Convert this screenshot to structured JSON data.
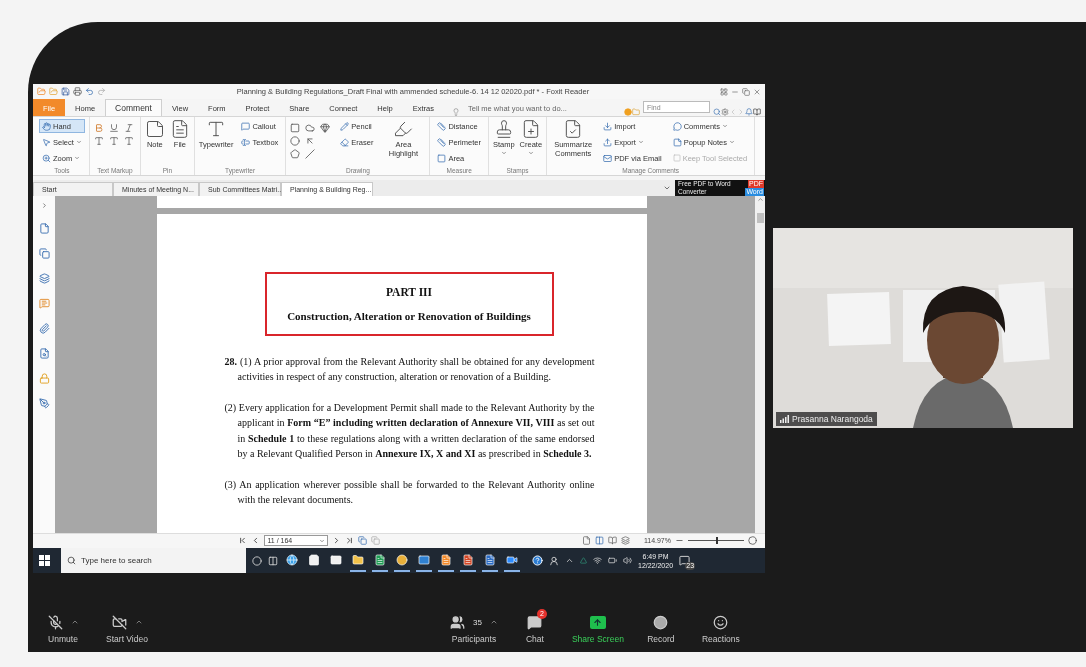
{
  "app_window": {
    "title": "Planning & Building Regulations_Draft Final with ammended schedule-6. 14 12 02020.pdf * - Foxit Reader",
    "menu_tabs": [
      {
        "label": "File",
        "kind": "file",
        "selected": false
      },
      {
        "label": "Home",
        "kind": "tab",
        "selected": false
      },
      {
        "label": "Comment",
        "kind": "tab",
        "selected": true
      },
      {
        "label": "View",
        "kind": "tab",
        "selected": false
      },
      {
        "label": "Form",
        "kind": "tab",
        "selected": false
      },
      {
        "label": "Protect",
        "kind": "tab",
        "selected": false
      },
      {
        "label": "Share",
        "kind": "tab",
        "selected": false
      },
      {
        "label": "Connect",
        "kind": "tab",
        "selected": false
      },
      {
        "label": "Help",
        "kind": "tab",
        "selected": false
      },
      {
        "label": "Extras",
        "kind": "tab",
        "selected": false
      }
    ],
    "tell_me": {
      "placeholder": "Tell me what you want to do..."
    },
    "find": {
      "placeholder": "Find"
    },
    "ribbon_groups": [
      {
        "label": "Tools",
        "kind": "tools",
        "items": [
          {
            "label": "Hand",
            "kind": "small",
            "selected": true,
            "dropdown": false
          },
          {
            "label": "Select",
            "kind": "small",
            "selected": false,
            "dropdown": true
          },
          {
            "label": "Zoom",
            "kind": "small",
            "selected": false,
            "dropdown": true
          }
        ]
      },
      {
        "label": "Text Markup",
        "kind": "markup"
      },
      {
        "label": "Pin",
        "kind": "pin",
        "items": [
          {
            "label": "Note",
            "kind": "large",
            "dropdown": false
          },
          {
            "label": "File",
            "kind": "large",
            "dropdown": false
          }
        ]
      },
      {
        "label": "Typewriter",
        "kind": "typewriter",
        "items": [
          {
            "label": "Typewriter",
            "kind": "large",
            "dropdown": false
          },
          {
            "label": "Callout",
            "kind": "small",
            "dropdown": false
          },
          {
            "label": "Textbox",
            "kind": "small",
            "dropdown": false
          }
        ]
      },
      {
        "label": "Drawing",
        "kind": "drawing",
        "items": [
          {
            "label": "Pencil",
            "kind": "small",
            "dropdown": false
          },
          {
            "label": "Eraser",
            "kind": "small",
            "dropdown": false
          },
          {
            "label": "Area Highlight",
            "kind": "large",
            "dropdown": false
          }
        ]
      },
      {
        "label": "Measure",
        "kind": "measure",
        "items": [
          {
            "label": "Distance",
            "kind": "small",
            "dropdown": false
          },
          {
            "label": "Perimeter",
            "kind": "small",
            "dropdown": false
          },
          {
            "label": "Area",
            "kind": "small",
            "dropdown": false
          }
        ]
      },
      {
        "label": "Stamps",
        "kind": "stamps",
        "items": [
          {
            "label": "Stamp",
            "kind": "large",
            "dropdown": true
          },
          {
            "label": "Create",
            "kind": "large",
            "dropdown": true
          }
        ]
      },
      {
        "label": "Manage Comments",
        "kind": "manage",
        "items": [
          {
            "label": "Summarize Comments",
            "kind": "large",
            "dropdown": false
          },
          {
            "label": "Import",
            "kind": "small",
            "dropdown": false
          },
          {
            "label": "Export",
            "kind": "small",
            "dropdown": true
          },
          {
            "label": "PDF via Email",
            "kind": "small",
            "dropdown": false
          },
          {
            "label": "Comments",
            "kind": "small",
            "dropdown": true
          },
          {
            "label": "Popup Notes",
            "kind": "small",
            "dropdown": true
          }
        ],
        "keep_tool_selected": {
          "label": "Keep Tool Selected",
          "disabled": true,
          "checked": false
        }
      }
    ],
    "doc_tabs": [
      {
        "label": "Start",
        "selected": false
      },
      {
        "label": "Minutes of Meeting N...",
        "selected": false
      },
      {
        "label": "Sub Committees Matri...",
        "selected": false
      },
      {
        "label": "Planning & Building Reg...",
        "selected": true
      }
    ],
    "ad": {
      "line_1": "Free PDF to Word",
      "line_2": "Converter",
      "badge_top": "PDF",
      "badge_bottom": "Word"
    },
    "document": {
      "heading": {
        "title": "PART III",
        "subtitle": "Construction, Alteration or Renovation of Buildings"
      },
      "section_number": "28.",
      "paragraphs": [
        "(1) A prior approval from the Relevant Authority shall be obtained for any development activities in respect of any construction, alteration or renovation of a Building.",
        "(2) Every application for a Development Permit shall made to the Relevant Authority by the applicant in **Form “E” including written declaration of Annexure VII, VIII** as set out in **Schedule 1** to these regulations along with a written declaration of the same endorsed by a Relevant Qualified Person in **Annexure IX, X and XI** as prescribed in **Schedule 3.**",
        "(3) An application wherever possible shall be forwarded to the Relevant Authority online with the relevant documents."
      ]
    },
    "status_bar": {
      "page": "11 / 164",
      "zoom": "114.97%",
      "zoom_slider": {
        "level": 0.5
      }
    }
  },
  "taskbar": {
    "search": {
      "placeholder": "Type here to search"
    },
    "apps": [
      {
        "kind": "edge",
        "running": false
      },
      {
        "kind": "store",
        "running": false
      },
      {
        "kind": "mail",
        "running": false
      },
      {
        "kind": "explorer",
        "running": true
      },
      {
        "kind": "excel",
        "running": true
      },
      {
        "kind": "chrome",
        "running": true
      },
      {
        "kind": "outlook",
        "running": true
      },
      {
        "kind": "foxit",
        "running": true
      },
      {
        "kind": "powerpoint",
        "running": true
      },
      {
        "kind": "word",
        "running": true
      },
      {
        "kind": "zoom",
        "running": true
      }
    ],
    "time": "6:49 PM",
    "date": "12/22/2020",
    "notification_count": "23"
  },
  "video": {
    "participant_name": "Prasanna Narangoda"
  },
  "meeting_toolbar": {
    "left_controls": [
      {
        "kind": "mic",
        "label": "Unmute",
        "menu": true
      },
      {
        "kind": "video",
        "label": "Start Video",
        "menu": true
      }
    ],
    "center_controls": [
      {
        "kind": "participants",
        "label": "Participants",
        "count": "35",
        "menu": true
      },
      {
        "kind": "chat",
        "label": "Chat",
        "badge": "2",
        "menu": false
      },
      {
        "kind": "share",
        "label": "Share Screen",
        "menu": false
      },
      {
        "kind": "record",
        "label": "Record",
        "menu": false
      },
      {
        "kind": "reactions",
        "label": "Reactions",
        "menu": false
      }
    ]
  }
}
